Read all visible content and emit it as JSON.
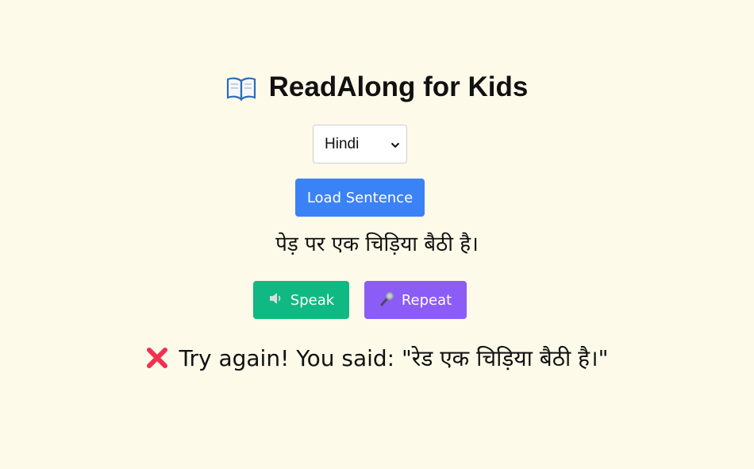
{
  "app": {
    "title": "ReadAlong for Kids",
    "title_icon": "open-book-icon"
  },
  "language_select": {
    "selected": "Hindi",
    "icon": "chevron-down-icon"
  },
  "buttons": {
    "load_label": "Load Sentence",
    "speak_label": "Speak",
    "speak_icon": "speaker-icon",
    "repeat_label": "Repeat",
    "repeat_icon": "microphone-icon"
  },
  "sentence": {
    "text": "पेड़ पर एक चिड़िया बैठी है।"
  },
  "feedback": {
    "icon": "cross-mark-icon",
    "text": "Try again! You said: \"रेड एक चिड़िया बैठी है।\""
  },
  "colors": {
    "background": "#fefae9",
    "load_button": "#3b82f6",
    "speak_button": "#10b981",
    "repeat_button": "#8b5cf6",
    "error_icon": "#f0314f"
  }
}
